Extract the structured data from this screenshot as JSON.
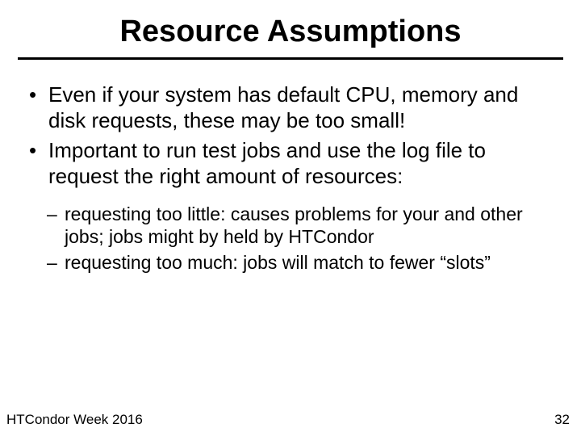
{
  "title": "Resource Assumptions",
  "bullets": {
    "b1": "Even if your system has default CPU, memory and disk requests, these may be too small!",
    "b2": "Important to run test jobs and use the log file to request the right amount of resources:",
    "sub1": "requesting too little: causes problems for your and other jobs; jobs might by held by HTCondor",
    "sub2": "requesting too much: jobs will match to fewer “slots”"
  },
  "footer": {
    "left": "HTCondor Week 2016",
    "right": "32"
  }
}
